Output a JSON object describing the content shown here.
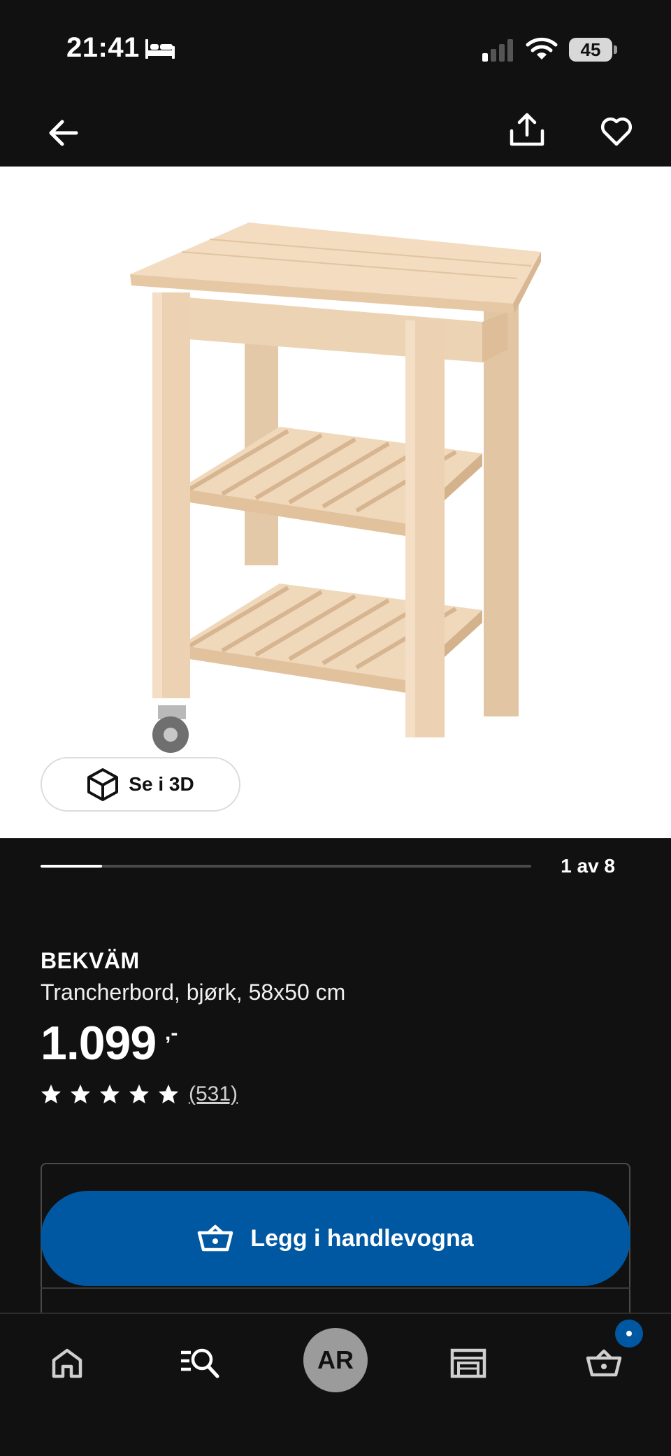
{
  "status_bar": {
    "time": "21:41",
    "battery": "45",
    "icons": [
      "bed-icon",
      "signal-icon",
      "wifi-icon",
      "battery-icon"
    ]
  },
  "header": {
    "icons": [
      "back-arrow-icon",
      "share-icon",
      "heart-icon"
    ]
  },
  "gallery": {
    "view_3d_label": "Se i 3D",
    "pager_text": "1 av 8",
    "current_image": 1,
    "total_images": 8
  },
  "product": {
    "brand": "BEKVÄM",
    "description": "Trancherbord, bjørk, 58x50 cm",
    "price": "1.099",
    "price_suffix": ",-",
    "rating_stars": 5,
    "review_count": "(531)"
  },
  "cart": {
    "add_label": "Legg i handlevogna"
  },
  "tab_bar": {
    "ar_label": "AR",
    "items": [
      "home-icon",
      "search-icon",
      "ar-button",
      "store-icon",
      "cart-icon"
    ]
  },
  "colors": {
    "background": "#111111",
    "accent_blue": "#0058a3",
    "image_background": "#ffffff",
    "wood": "#e8cfb0"
  }
}
